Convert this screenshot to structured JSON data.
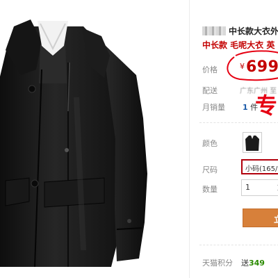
{
  "product": {
    "title": "中长款大衣外",
    "subtitle": "中长款 毛呢大衣 英"
  },
  "price": {
    "label": "价格",
    "currency": "¥",
    "value": "699"
  },
  "shipping": {
    "label": "配送",
    "destination": "广东广州 至"
  },
  "monthly_sales": {
    "label": "月销量",
    "count": "1",
    "unit": "件"
  },
  "promo": {
    "mark": "专"
  },
  "options": {
    "color_label": "颜色",
    "size_label": "尺码",
    "size_selected": "小码(165/",
    "quantity_label": "数量",
    "quantity_value": "1"
  },
  "actions": {
    "buy_label": "立"
  },
  "points": {
    "label": "天猫积分",
    "prefix": "送",
    "value": "349"
  },
  "colors": {
    "price_red": "#c40000",
    "promo_red": "#e60012",
    "buy_orange": "#d7803a",
    "size_border": "#b2000c",
    "points_green": "#2a8a00"
  }
}
